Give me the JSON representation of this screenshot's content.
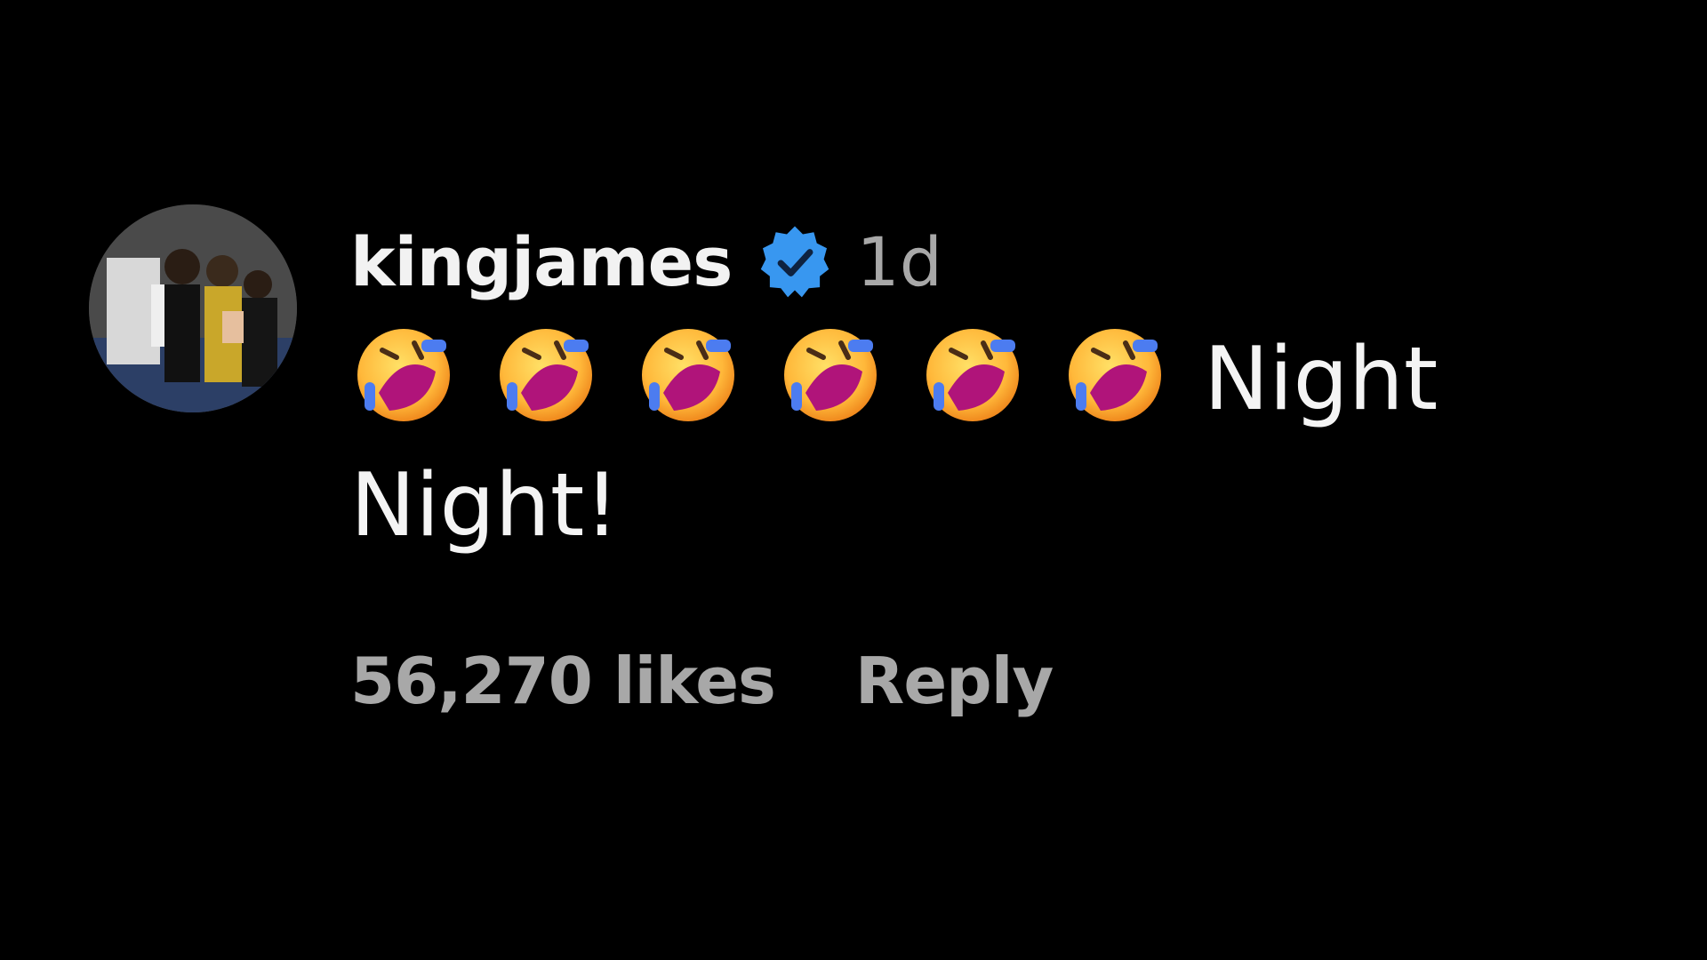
{
  "comment": {
    "username": "kingjames",
    "verified": true,
    "verified_icon": "verified-badge-icon",
    "timestamp": "1d",
    "emoji_icon": "rolling-on-floor-laughing-emoji",
    "emoji_count": 6,
    "text_line1": "Night",
    "text_line2": "Night!",
    "likes": "56,270 likes",
    "reply_label": "Reply",
    "colors": {
      "background": "#000000",
      "username": "#f2f2f2",
      "secondary_text": "#a8a8a8",
      "verified_badge": "#3897f0"
    }
  }
}
